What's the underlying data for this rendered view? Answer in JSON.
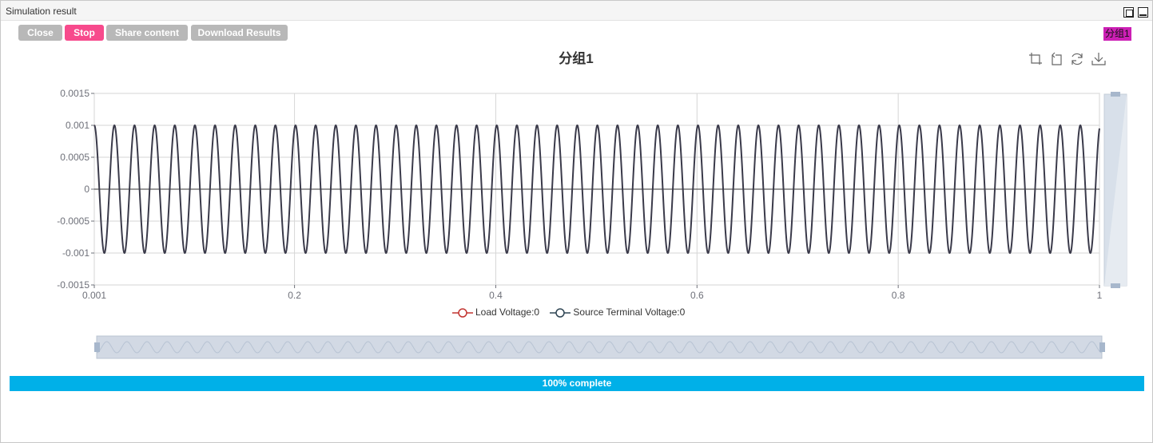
{
  "window": {
    "title": "Simulation result"
  },
  "toolbar": {
    "close_label": "Close",
    "stop_label": "Stop",
    "share_label": "Share content",
    "download_label": "Download Results"
  },
  "group_tag": "分组1",
  "progress": {
    "label": "100% complete",
    "value": 1.0
  },
  "colors": {
    "stop_button": "#f74a8c",
    "progress_bar": "#00b0e8",
    "group_tag": "#cc1fb4",
    "load_voltage": "#c23531",
    "source_voltage": "#2f4554"
  },
  "toolbox": [
    "zoom-icon",
    "zoom-reset-icon",
    "restore-icon",
    "save-image-icon"
  ],
  "chart_data": {
    "type": "line",
    "title": "分组1",
    "xlim": [
      0.001,
      1
    ],
    "ylim": [
      -0.0015,
      0.0015
    ],
    "x_ticks": [
      "0.001",
      "0.2",
      "0.4",
      "0.6",
      "0.8",
      "1"
    ],
    "y_ticks": [
      "0.0015",
      "0.001",
      "0.0005",
      "0",
      "-0.0005",
      "-0.001",
      "-0.0015"
    ],
    "x_tick_values": [
      0.001,
      0.2,
      0.4,
      0.6,
      0.8,
      1
    ],
    "y_tick_values": [
      0.0015,
      0.001,
      0.0005,
      0,
      -0.0005,
      -0.001,
      -0.0015
    ],
    "grid": true,
    "legend_position": "bottom",
    "series": [
      {
        "name": "Load Voltage:0",
        "amplitude": 0.001,
        "frequency": 50,
        "color": "#c23531"
      },
      {
        "name": "Source Terminal Voltage:0",
        "amplitude": 0.001,
        "frequency": 50,
        "color": "#2f4554"
      }
    ]
  }
}
